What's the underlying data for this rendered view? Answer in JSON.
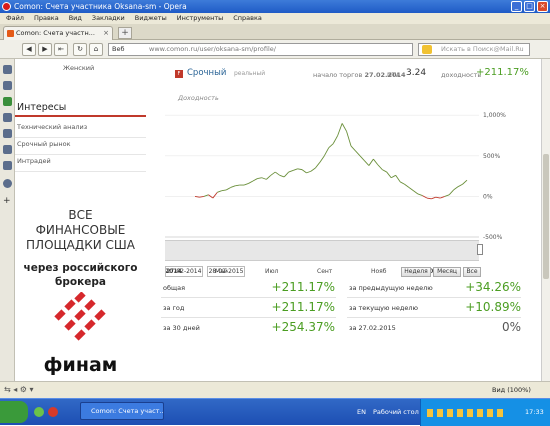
{
  "window": {
    "title": "Comon: Счета участника Oksana-sm - Opera"
  },
  "menu": [
    "Файл",
    "Правка",
    "Вид",
    "Закладки",
    "Виджеты",
    "Инструменты",
    "Справка"
  ],
  "tab": {
    "label": "Comon: Счета участн..."
  },
  "address": {
    "scheme_label": "Веб",
    "url": "www.comon.ru/user/oksana-sm/profile/"
  },
  "search": {
    "placeholder": "Искать в Поиск@Mail.Ru"
  },
  "sidebar": {
    "gender": "Женский",
    "interests_title": "Интересы",
    "items": [
      "Технический анализ",
      "Срочный рынок",
      "Интрадей"
    ]
  },
  "ad": {
    "line1": "ВСЕ",
    "line2": "ФИНАНСОВЫЕ",
    "line3": "ПЛОЩАДКИ США",
    "line4": "через российского",
    "line5": "брокера",
    "brand": "финам"
  },
  "account": {
    "name": "Срочный",
    "badge": "F",
    "type": "реальный",
    "start_label": "начало торгов",
    "start_date": "27.02.2014",
    "ita_label": "ИТА",
    "ita_value": "3.24",
    "return_label": "доходность",
    "return_value": "+211.17%"
  },
  "chart_data": {
    "type": "line",
    "title": "Доходность",
    "ylim": [
      -500,
      1200
    ],
    "y_ticks": [
      "1,000%",
      "500%",
      "0%",
      "-500%"
    ],
    "x_ticks": [
      "2014",
      "Май",
      "Июл",
      "Сент",
      "Нояб",
      "2015"
    ],
    "navigator_ticks": [
      "2014",
      "Май",
      "Июл",
      "Сент",
      "Нояб",
      "2015"
    ],
    "series": [
      {
        "values": [
          [
            0,
            0
          ],
          [
            2,
            -10
          ],
          [
            4,
            0
          ],
          [
            6,
            20
          ],
          [
            8,
            -20
          ],
          [
            10,
            50
          ],
          [
            12,
            70
          ],
          [
            14,
            80
          ],
          [
            16,
            110
          ],
          [
            18,
            130
          ],
          [
            20,
            140
          ],
          [
            22,
            140
          ],
          [
            24,
            160
          ],
          [
            26,
            190
          ],
          [
            28,
            220
          ],
          [
            30,
            230
          ],
          [
            32,
            210
          ],
          [
            34,
            260
          ],
          [
            36,
            300
          ],
          [
            38,
            260
          ],
          [
            40,
            240
          ],
          [
            42,
            300
          ],
          [
            44,
            320
          ],
          [
            46,
            340
          ],
          [
            48,
            330
          ],
          [
            50,
            290
          ],
          [
            52,
            310
          ],
          [
            54,
            350
          ],
          [
            56,
            420
          ],
          [
            58,
            500
          ],
          [
            60,
            600
          ],
          [
            62,
            650
          ],
          [
            64,
            750
          ],
          [
            66,
            900
          ],
          [
            68,
            800
          ],
          [
            70,
            620
          ],
          [
            72,
            560
          ],
          [
            74,
            500
          ],
          [
            76,
            440
          ],
          [
            78,
            380
          ],
          [
            80,
            460
          ],
          [
            82,
            390
          ],
          [
            84,
            330
          ],
          [
            86,
            300
          ],
          [
            88,
            230
          ],
          [
            90,
            260
          ],
          [
            92,
            180
          ],
          [
            94,
            150
          ],
          [
            96,
            110
          ],
          [
            98,
            70
          ],
          [
            100,
            30
          ],
          [
            102,
            10
          ],
          [
            104,
            -20
          ],
          [
            106,
            -30
          ],
          [
            108,
            -10
          ],
          [
            110,
            -20
          ],
          [
            112,
            0
          ],
          [
            114,
            20
          ],
          [
            116,
            80
          ],
          [
            118,
            120
          ],
          [
            120,
            150
          ],
          [
            122,
            200
          ]
        ]
      }
    ],
    "grid": true
  },
  "dates": {
    "from": "27-02-2014",
    "to": "28-02-2015"
  },
  "range_buttons": [
    "Неделя",
    "Месяц",
    "Все"
  ],
  "stats": {
    "total_label": "общая",
    "total_value": "+211.17%",
    "year_label": "за год",
    "year_value": "+211.17%",
    "days30_label": "за 30 дней",
    "days30_value": "+254.37%",
    "prev_week_label": "за предыдущую неделю",
    "prev_week_value": "+34.26%",
    "cur_week_label": "за текущую неделю",
    "cur_week_value": "+10.89%",
    "day_label": "за 27.02.2015",
    "day_value": "0%"
  },
  "status": {
    "zoom": "Вид (100%)"
  },
  "taskbar": {
    "item": "Comon: Счета участ...",
    "lang": "EN",
    "desktop": "Рабочий стол",
    "time": "17:33"
  },
  "colors": {
    "positive": "#4b9d22",
    "accent": "#c0392b",
    "line": "#6a8f3a"
  }
}
